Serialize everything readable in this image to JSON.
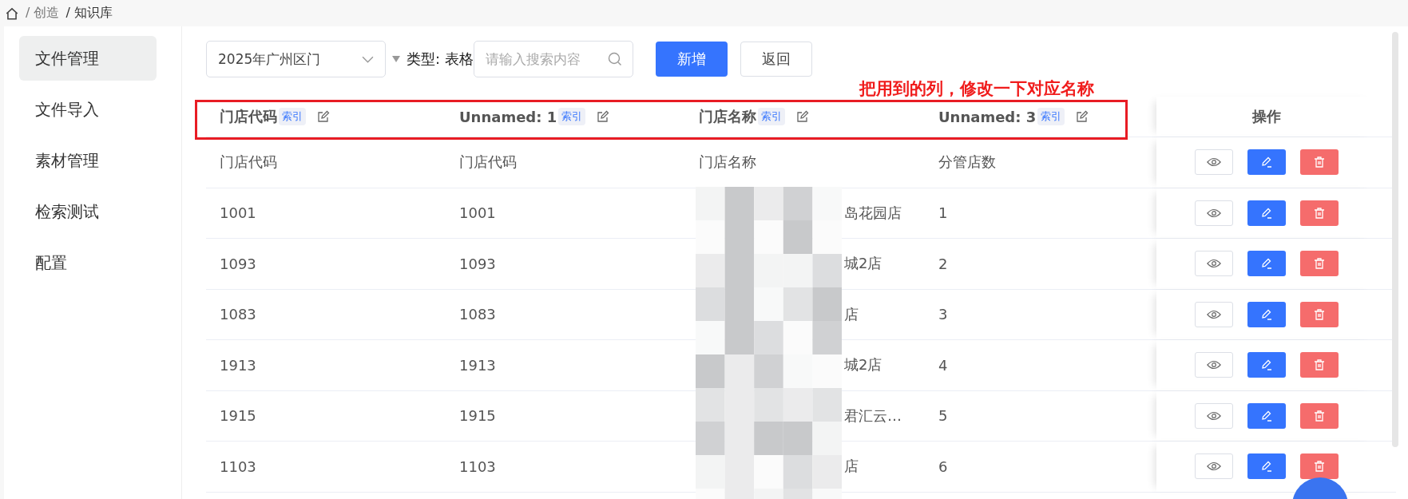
{
  "breadcrumb": [
    "/ 创造",
    "/ 知识库"
  ],
  "sidebar": {
    "items": [
      {
        "label": "文件管理",
        "selected": true
      },
      {
        "label": "文件导入",
        "selected": false
      },
      {
        "label": "素材管理",
        "selected": false
      },
      {
        "label": "检索测试",
        "selected": false
      },
      {
        "label": "配置",
        "selected": false
      }
    ]
  },
  "toolbar": {
    "file_select": "2025年广州区门",
    "type_label": "类型: 表格",
    "search": {
      "placeholder": "请输入搜索内容"
    },
    "buttons": [
      {
        "label": "新增",
        "kind": "primary"
      },
      {
        "label": "返回",
        "kind": "plain"
      }
    ]
  },
  "annotation": "把用到的列，修改一下对应名称",
  "table": {
    "columns": [
      {
        "name": "门店代码",
        "badge": "索引"
      },
      {
        "name": "Unnamed: 1",
        "badge": "索引"
      },
      {
        "name": "门店名称",
        "badge": "索引"
      },
      {
        "name": "Unnamed: 3",
        "badge": "索引"
      }
    ],
    "actions_header": "操作",
    "rows": [
      [
        "门店代码",
        "门店代码",
        "门店名称",
        "分管店数"
      ],
      [
        "1001",
        "1001",
        "岛花园店",
        "1"
      ],
      [
        "1093",
        "1093",
        "城2店",
        "2"
      ],
      [
        "1083",
        "1083",
        "店",
        "3"
      ],
      [
        "1913",
        "1913",
        "城2店",
        "4"
      ],
      [
        "1915",
        "1915",
        "君汇云…",
        "5"
      ],
      [
        "1103",
        "1103",
        "店",
        "6"
      ]
    ]
  }
}
